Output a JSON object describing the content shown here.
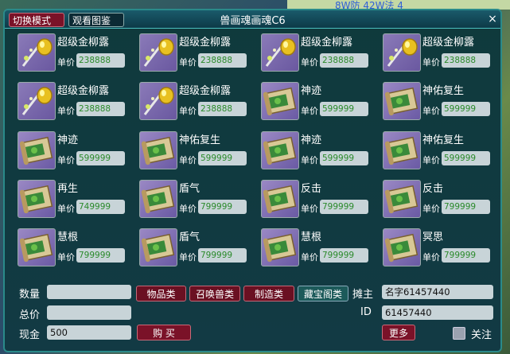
{
  "background": {
    "top_right_text": "8W防  42W法  4"
  },
  "window": {
    "title": "兽画魂画魂C6",
    "switch_label": "切换模式",
    "view_label": "观看图鉴",
    "close_label": "×"
  },
  "grid": {
    "price_label": "单价",
    "cells": [
      {
        "name": "超级金柳露",
        "price": "238888",
        "icon": "gold-dew-icon"
      },
      {
        "name": "超级金柳露",
        "price": "238888",
        "icon": "gold-dew-icon"
      },
      {
        "name": "超级金柳露",
        "price": "238888",
        "icon": "gold-dew-icon"
      },
      {
        "name": "超级金柳露",
        "price": "238888",
        "icon": "gold-dew-icon"
      },
      {
        "name": "超级金柳露",
        "price": "238888",
        "icon": "gold-dew-icon"
      },
      {
        "name": "超级金柳露",
        "price": "238888",
        "icon": "gold-dew-icon"
      },
      {
        "name": "神迹",
        "price": "599999",
        "icon": "skill-scroll-icon"
      },
      {
        "name": "神佑复生",
        "price": "599999",
        "icon": "skill-scroll-icon"
      },
      {
        "name": "神迹",
        "price": "599999",
        "icon": "skill-scroll-icon"
      },
      {
        "name": "神佑复生",
        "price": "599999",
        "icon": "skill-scroll-icon"
      },
      {
        "name": "神迹",
        "price": "599999",
        "icon": "skill-scroll-icon"
      },
      {
        "name": "神佑复生",
        "price": "599999",
        "icon": "skill-scroll-icon"
      },
      {
        "name": "再生",
        "price": "749999",
        "icon": "skill-scroll-icon"
      },
      {
        "name": "盾气",
        "price": "799999",
        "icon": "skill-scroll-icon"
      },
      {
        "name": "反击",
        "price": "799999",
        "icon": "skill-scroll-icon"
      },
      {
        "name": "反击",
        "price": "799999",
        "icon": "skill-scroll-icon"
      },
      {
        "name": "慧根",
        "price": "799999",
        "icon": "skill-scroll-icon"
      },
      {
        "name": "盾气",
        "price": "799999",
        "icon": "skill-scroll-icon"
      },
      {
        "name": "慧根",
        "price": "799999",
        "icon": "skill-scroll-icon"
      },
      {
        "name": "冥思",
        "price": "799999",
        "icon": "skill-scroll-icon"
      }
    ]
  },
  "bottom": {
    "quantity_label": "数量",
    "quantity_value": "",
    "total_label": "总价",
    "total_value": "",
    "cash_label": "现金",
    "cash_value": "500",
    "cat_items": "物品类",
    "cat_summon": "召唤兽类",
    "cat_craft": "制造类",
    "cat_treasure": "藏宝阁类",
    "buy_label": "购 买",
    "seller_label": "摊主",
    "seller_value": "名字61457440",
    "id_label": "ID",
    "id_value": "61457440",
    "more_label": "更多",
    "follow_label": "关注"
  }
}
